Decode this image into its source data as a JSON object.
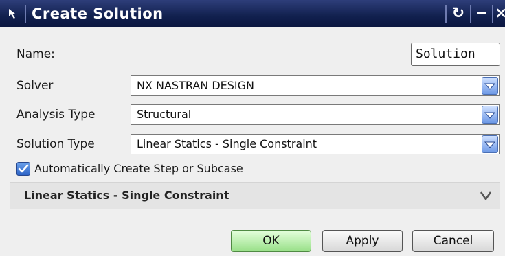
{
  "window": {
    "title": "Create Solution",
    "reset_glyph": "↻",
    "minimize_glyph": "−",
    "close_glyph": "×"
  },
  "form": {
    "name_label": "Name:",
    "name_value": "Solution",
    "solver_label": "Solver",
    "solver_value": "NX NASTRAN DESIGN",
    "analysis_label": "Analysis Type",
    "analysis_value": "Structural",
    "solution_label": "Solution Type",
    "solution_value": "Linear Statics - Single Constraint",
    "auto_create_label": "Automatically Create Step or Subcase",
    "auto_create_checked": true
  },
  "group": {
    "title": "Linear Statics - Single Constraint"
  },
  "buttons": {
    "ok": "OK",
    "apply": "Apply",
    "cancel": "Cancel"
  },
  "colors": {
    "titlebar": "#11204e",
    "ok_button": "#99e089",
    "dropdown_accent": "#6e99e6"
  }
}
